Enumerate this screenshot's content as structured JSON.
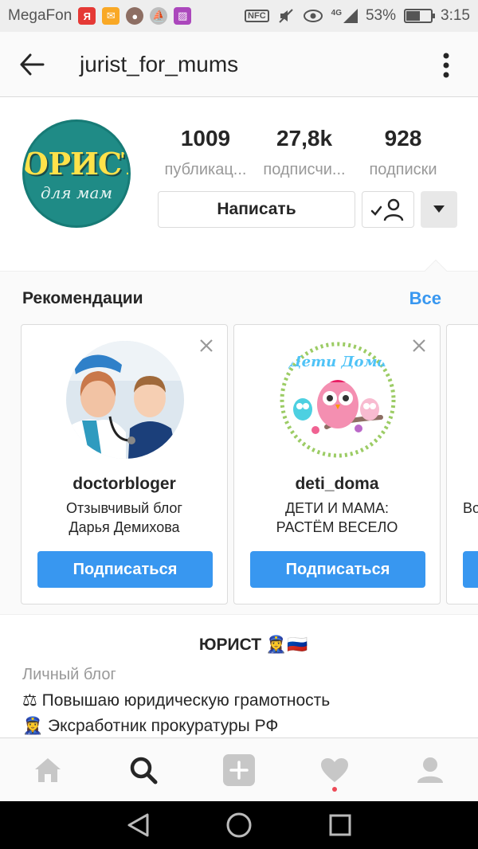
{
  "status_bar": {
    "carrier": "MegaFon",
    "network": "4G",
    "battery": "53%",
    "battery_level": 0.53,
    "time": "3:15"
  },
  "header": {
    "username": "jurist_for_mums"
  },
  "profile": {
    "avatar_text_main": "ЮРИСТ",
    "avatar_text_sub": "для мам",
    "stats": [
      {
        "value": "1009",
        "label": "публикац..."
      },
      {
        "value": "27,8k",
        "label": "подписчи..."
      },
      {
        "value": "928",
        "label": "подписки"
      }
    ],
    "message_label": "Написать"
  },
  "recommendations": {
    "title": "Рекомендации",
    "see_all": "Все",
    "cards": [
      {
        "username": "doctorbloger",
        "desc_line1": "Отзывчивый блог",
        "desc_line2": "Дарья Демихова",
        "button": "Подписаться"
      },
      {
        "username": "deti_doma",
        "desc_line1": "ДЕТИ И МАМА:",
        "desc_line2": "РАСТЁМ ВЕСЕЛО",
        "button": "Подписаться",
        "logo_text": "Дети Дома"
      },
      {
        "desc_line1": "Во"
      }
    ]
  },
  "bio": {
    "name": "ЮРИСТ 👮‍♀🇷🇺",
    "category": "Личный блог",
    "line1": "⚖ Повышаю юридическую грамотность",
    "line2": "👮‍♀ Экс‍работник прокуратуры РФ"
  },
  "colors": {
    "accent": "#3897f0",
    "notification": "#ed4956",
    "avatar_bg": "#1f8b86"
  }
}
